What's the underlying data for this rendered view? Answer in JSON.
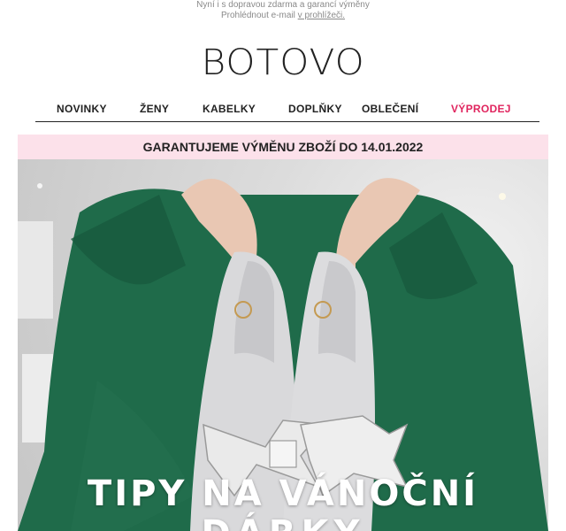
{
  "preheader": {
    "line1": "Nyní i s dopravou zdarma a garancí výměny",
    "line2_text": "Prohlédnout e-mail ",
    "line2_link": "v prohlížeči."
  },
  "logo": {
    "text": "BOTOVO"
  },
  "nav": {
    "items": [
      {
        "label": "NOVINKY"
      },
      {
        "label": "ŽENY"
      },
      {
        "label": "KABELKY"
      },
      {
        "label": "DOPLŇKY"
      },
      {
        "label": "OBLEČENÍ"
      },
      {
        "label": "VÝPRODEJ"
      }
    ],
    "sale_color": "#e0245e"
  },
  "banner": {
    "text": "GARANTUJEME VÝMĚNU ZBOŽÍ DO 14.01.2022",
    "bg_color": "#fce1ea"
  },
  "hero": {
    "title_line1": "TIPY NA VÁNOČNÍ",
    "title_line2": "DÁRKY",
    "dress_color": "#1f6b4a",
    "image": "woman-holding-silver-heels-photo"
  }
}
